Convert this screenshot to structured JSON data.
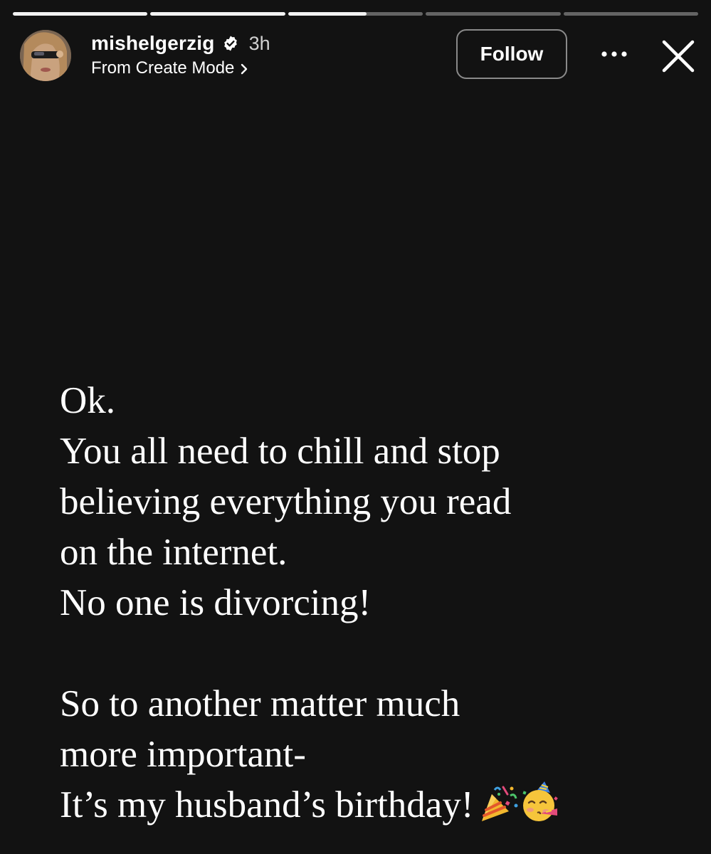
{
  "progress": {
    "segments": [
      1,
      1,
      0.58,
      0,
      0
    ]
  },
  "header": {
    "username": "mishelgerzig",
    "time_ago": "3h",
    "source": "From Create Mode",
    "follow_label": "Follow"
  },
  "icons": {
    "verified": "verified-badge-icon",
    "chevron": "chevron-right-icon",
    "more": "more-options-icon",
    "close": "close-icon",
    "party_popper": "party-popper-emoji",
    "party_face": "partying-face-emoji"
  },
  "message": {
    "block1": [
      "Ok.",
      "You all need to chill and stop",
      "believing everything you read",
      "on the internet.",
      "No one is divorcing!"
    ],
    "block2": [
      "So to another matter much",
      "more important-"
    ],
    "last_line": "It’s my husband’s birthday!"
  },
  "colors": {
    "background": "#121212",
    "text": "#ffffff",
    "progress_active": "#f2f2f2",
    "progress_inactive": "#5a5a5a"
  }
}
